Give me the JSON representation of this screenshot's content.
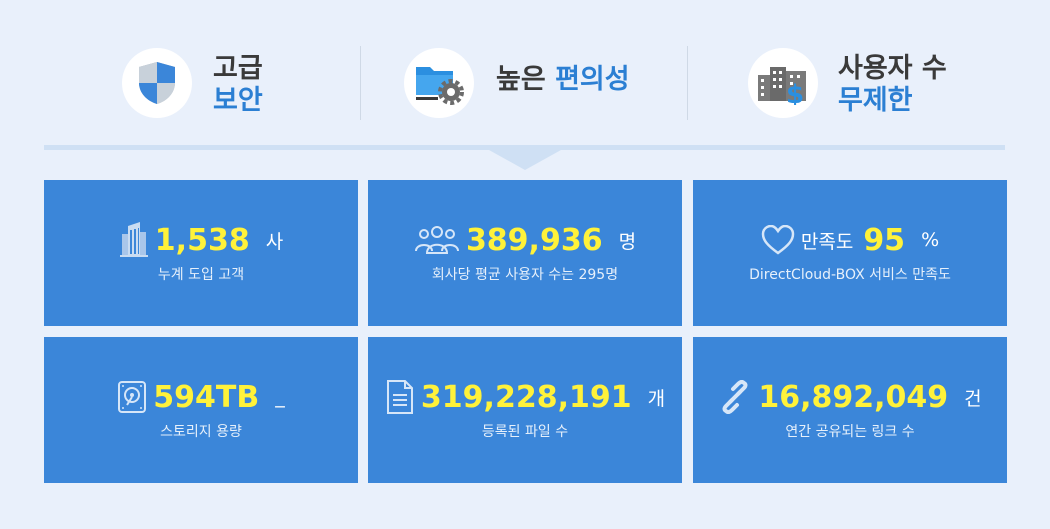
{
  "features": [
    {
      "line1": "고급",
      "line2": "보안",
      "icon": "shield-icon"
    },
    {
      "dark": "높은",
      "blue": "편의성",
      "icon": "folder-gear-icon"
    },
    {
      "line1": "사용자 수",
      "line2": "무제한",
      "icon": "buildings-dollar-icon"
    }
  ],
  "stats": [
    {
      "value": "1,538",
      "unit": "사",
      "desc": "누계 도입 고객",
      "icon": "building-icon"
    },
    {
      "value": "389,936",
      "unit": "명",
      "desc": "회사당 평균 사용자 수는 295명",
      "icon": "users-icon"
    },
    {
      "prefix": "만족도",
      "value": "95",
      "unit": "%",
      "desc": "DirectCloud-BOX 서비스 만족도",
      "icon": "heart-icon"
    },
    {
      "value": "594TB",
      "unit": "_",
      "desc": "스토리지 용량",
      "icon": "hard-drive-icon"
    },
    {
      "value": "319,228,191",
      "unit": "개",
      "desc": "등록된 파일 수",
      "icon": "document-icon"
    },
    {
      "value": "16,892,049",
      "unit": "건",
      "desc": "연간 공유되는 링크 수",
      "icon": "link-icon"
    }
  ],
  "colors": {
    "card": "#3b86d9",
    "number": "#fff23a",
    "accent": "#2b7fd3",
    "background": "#e9f0fb"
  }
}
